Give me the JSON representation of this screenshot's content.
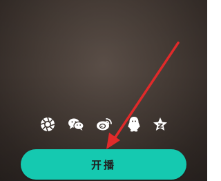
{
  "live_start": {
    "button_label": "开播",
    "button_color": "#15c9b0"
  },
  "share_targets": [
    {
      "icon": "moments-icon"
    },
    {
      "icon": "wechat-icon"
    },
    {
      "icon": "weibo-icon"
    },
    {
      "icon": "qq-icon"
    },
    {
      "icon": "qzone-icon"
    }
  ],
  "annotation": {
    "arrow_color": "#e02a2a"
  }
}
